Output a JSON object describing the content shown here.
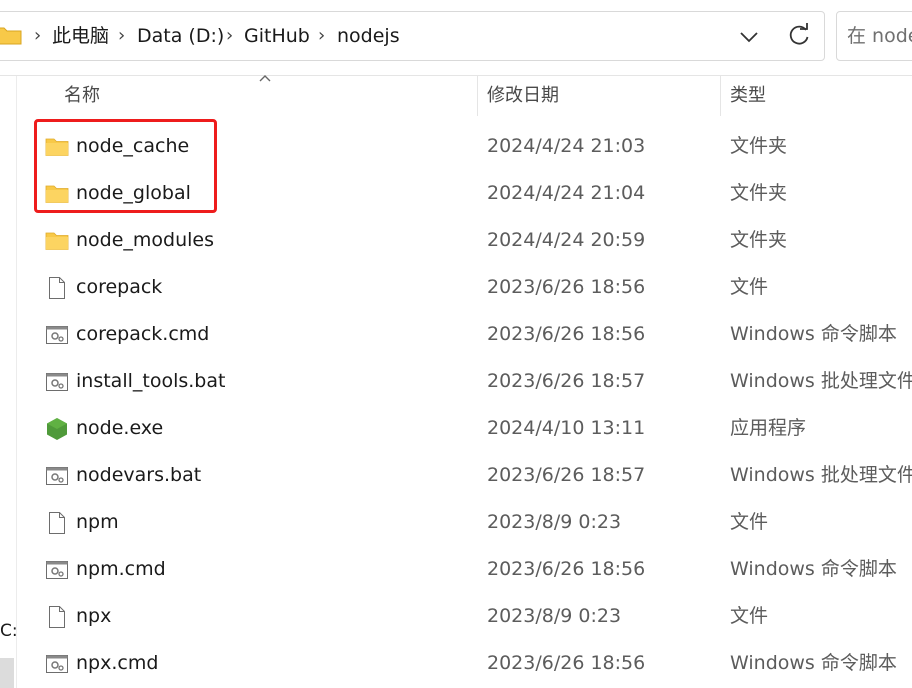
{
  "breadcrumb": {
    "items": [
      "此电脑",
      "Data (D:)",
      "GitHub",
      "nodejs"
    ],
    "separator": "›"
  },
  "search": {
    "placeholder": "在 node"
  },
  "left_pane": {
    "drive_label": "C:"
  },
  "columns": {
    "name": "名称",
    "modified": "修改日期",
    "type": "类型"
  },
  "files": [
    {
      "name": "node_cache",
      "modified": "2024/4/24 21:03",
      "type": "文件夹",
      "icon": "folder-icon"
    },
    {
      "name": "node_global",
      "modified": "2024/4/24 21:04",
      "type": "文件夹",
      "icon": "folder-icon"
    },
    {
      "name": "node_modules",
      "modified": "2024/4/24 20:59",
      "type": "文件夹",
      "icon": "folder-icon"
    },
    {
      "name": "corepack",
      "modified": "2023/6/26 18:56",
      "type": "文件",
      "icon": "file-icon"
    },
    {
      "name": "corepack.cmd",
      "modified": "2023/6/26 18:56",
      "type": "Windows 命令脚本",
      "icon": "script-icon"
    },
    {
      "name": "install_tools.bat",
      "modified": "2023/6/26 18:57",
      "type": "Windows 批处理文件",
      "icon": "script-icon"
    },
    {
      "name": "node.exe",
      "modified": "2024/4/10 13:11",
      "type": "应用程序",
      "icon": "node-exe-icon"
    },
    {
      "name": "nodevars.bat",
      "modified": "2023/6/26 18:57",
      "type": "Windows 批处理文件",
      "icon": "script-icon"
    },
    {
      "name": "npm",
      "modified": "2023/8/9 0:23",
      "type": "文件",
      "icon": "file-icon"
    },
    {
      "name": "npm.cmd",
      "modified": "2023/6/26 18:56",
      "type": "Windows 命令脚本",
      "icon": "script-icon"
    },
    {
      "name": "npx",
      "modified": "2023/8/9 0:23",
      "type": "文件",
      "icon": "file-icon"
    },
    {
      "name": "npx.cmd",
      "modified": "2023/6/26 18:56",
      "type": "Windows 命令脚本",
      "icon": "script-icon"
    }
  ],
  "colors": {
    "highlight": "#ee1c1c",
    "folder": "#f8c948",
    "node_green": "#4f9a3a"
  }
}
